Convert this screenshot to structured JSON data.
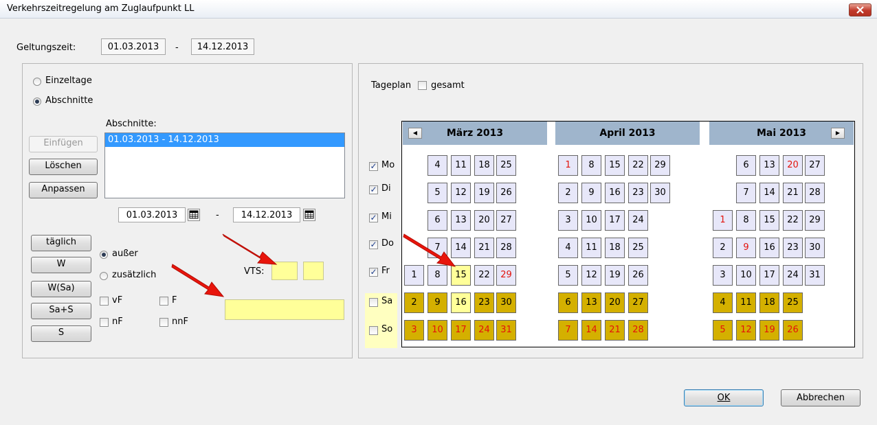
{
  "window": {
    "title": "Verkehrszeitregelung am Zuglaufpunkt LL"
  },
  "validity": {
    "label": "Geltungszeit:",
    "from": "01.03.2013",
    "dash": "-",
    "to": "14.12.2013"
  },
  "mode": {
    "einzeltage": "Einzeltage",
    "abschnitte": "Abschnitte",
    "selected": "Abschnitte"
  },
  "sections": {
    "label": "Abschnitte:",
    "items": [
      "01.03.2013 - 14.12.2013"
    ],
    "buttons": {
      "insert": "Einfügen",
      "delete": "Löschen",
      "adjust": "Anpassen"
    },
    "from": "01.03.2013",
    "dash": "-",
    "to": "14.12.2013"
  },
  "daybuttons": {
    "taeglich": "täglich",
    "w": "W",
    "wsa": "W(Sa)",
    "sas": "Sa+S",
    "s": "S"
  },
  "options": {
    "ausser": "außer",
    "zusaetzlich": "zusätzlich",
    "selected": "außer",
    "vf": "vF",
    "f": "F",
    "nf": "nF",
    "nnf": "nnF",
    "vts_label": "VTS:"
  },
  "tageplan": {
    "label": "Tageplan",
    "gesamt": "gesamt"
  },
  "weekdays": [
    {
      "label": "Mo",
      "checked": true
    },
    {
      "label": "Di",
      "checked": true
    },
    {
      "label": "Mi",
      "checked": true
    },
    {
      "label": "Do",
      "checked": true
    },
    {
      "label": "Fr",
      "checked": true
    },
    {
      "label": "Sa",
      "checked": false
    },
    {
      "label": "So",
      "checked": false
    }
  ],
  "months": [
    {
      "name": "März 2013",
      "rows": [
        [
          "",
          "4",
          "11",
          "18",
          "25"
        ],
        [
          "",
          "5",
          "12",
          "19",
          "26"
        ],
        [
          "",
          "6",
          "13",
          "20",
          "27"
        ],
        [
          "",
          "7",
          "14",
          "21",
          "28"
        ],
        [
          "1",
          "8",
          "15",
          "22",
          "29"
        ],
        [
          "2",
          "9",
          "16",
          "23",
          "30"
        ],
        [
          "3",
          "10",
          "17",
          "24",
          "31"
        ]
      ],
      "red": [
        "29",
        "3",
        "10",
        "17",
        "24",
        "31"
      ],
      "selected": [
        "15",
        "16"
      ]
    },
    {
      "name": "April 2013",
      "rows": [
        [
          "1",
          "8",
          "15",
          "22",
          "29"
        ],
        [
          "2",
          "9",
          "16",
          "23",
          "30"
        ],
        [
          "3",
          "10",
          "17",
          "24",
          ""
        ],
        [
          "4",
          "11",
          "18",
          "25",
          ""
        ],
        [
          "5",
          "12",
          "19",
          "26",
          ""
        ],
        [
          "6",
          "13",
          "20",
          "27",
          ""
        ],
        [
          "7",
          "14",
          "21",
          "28",
          ""
        ]
      ],
      "red": [
        "1",
        "7",
        "14",
        "21",
        "28"
      ],
      "selected": []
    },
    {
      "name": "Mai 2013",
      "rows": [
        [
          "",
          "6",
          "13",
          "20",
          "27"
        ],
        [
          "",
          "7",
          "14",
          "21",
          "28"
        ],
        [
          "1",
          "8",
          "15",
          "22",
          "29"
        ],
        [
          "2",
          "9",
          "16",
          "23",
          "30"
        ],
        [
          "3",
          "10",
          "17",
          "24",
          "31"
        ],
        [
          "4",
          "11",
          "18",
          "25",
          ""
        ],
        [
          "5",
          "12",
          "19",
          "26",
          ""
        ]
      ],
      "red": [
        "20",
        "1",
        "9",
        "5",
        "12",
        "19",
        "26"
      ],
      "selected": []
    }
  ],
  "footer": {
    "ok": "OK",
    "cancel": "Abbrechen"
  },
  "colors": {
    "weekday_cell": "#e7e7f9",
    "weekend_cell": "#d4b000",
    "selected_cell": "#ffff99",
    "holiday_text": "#e3120b",
    "month_header": "#9fb5cc",
    "annotation_arrow": "#e8150c"
  }
}
